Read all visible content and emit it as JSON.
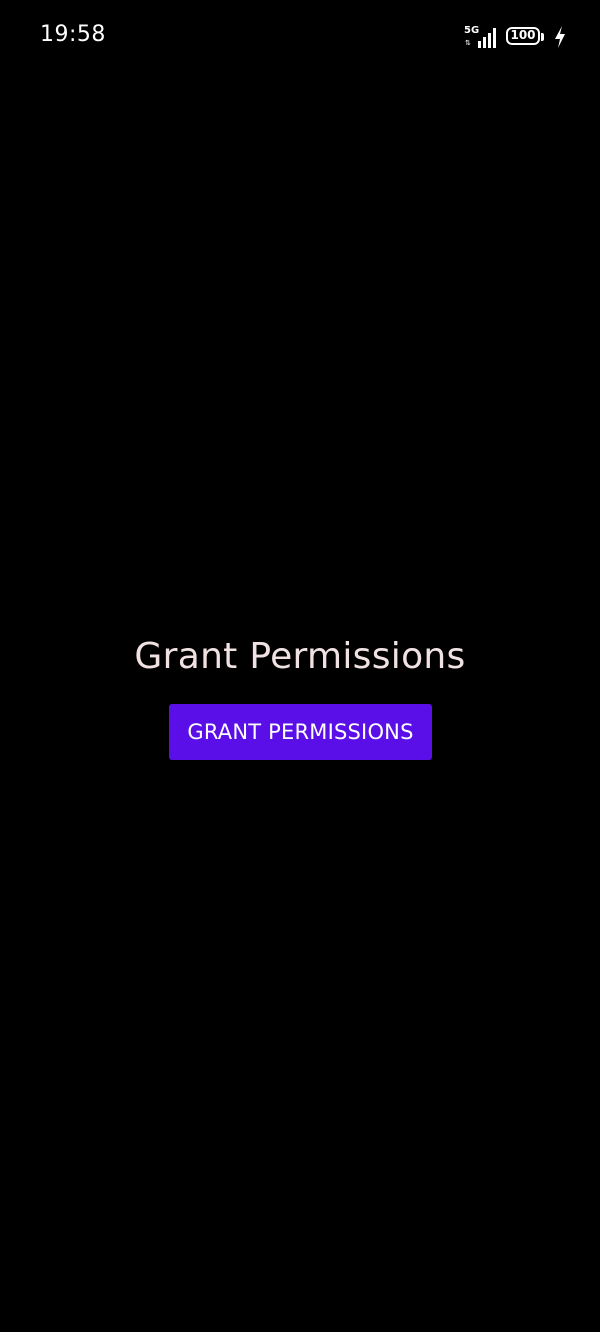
{
  "status_bar": {
    "time": "19:58",
    "network_type": "5G",
    "battery_level": "100",
    "charging": true,
    "icons": [
      "network-5g-icon",
      "signal-strength-icon",
      "battery-icon",
      "charging-bolt-icon"
    ]
  },
  "main": {
    "title": "Grant Permissions",
    "button_label": "GRANT PERMISSIONS"
  },
  "colors": {
    "background": "#000000",
    "title_text": "#f0e2e2",
    "button_background": "#5a0fe8",
    "button_text": "#ffffff"
  }
}
